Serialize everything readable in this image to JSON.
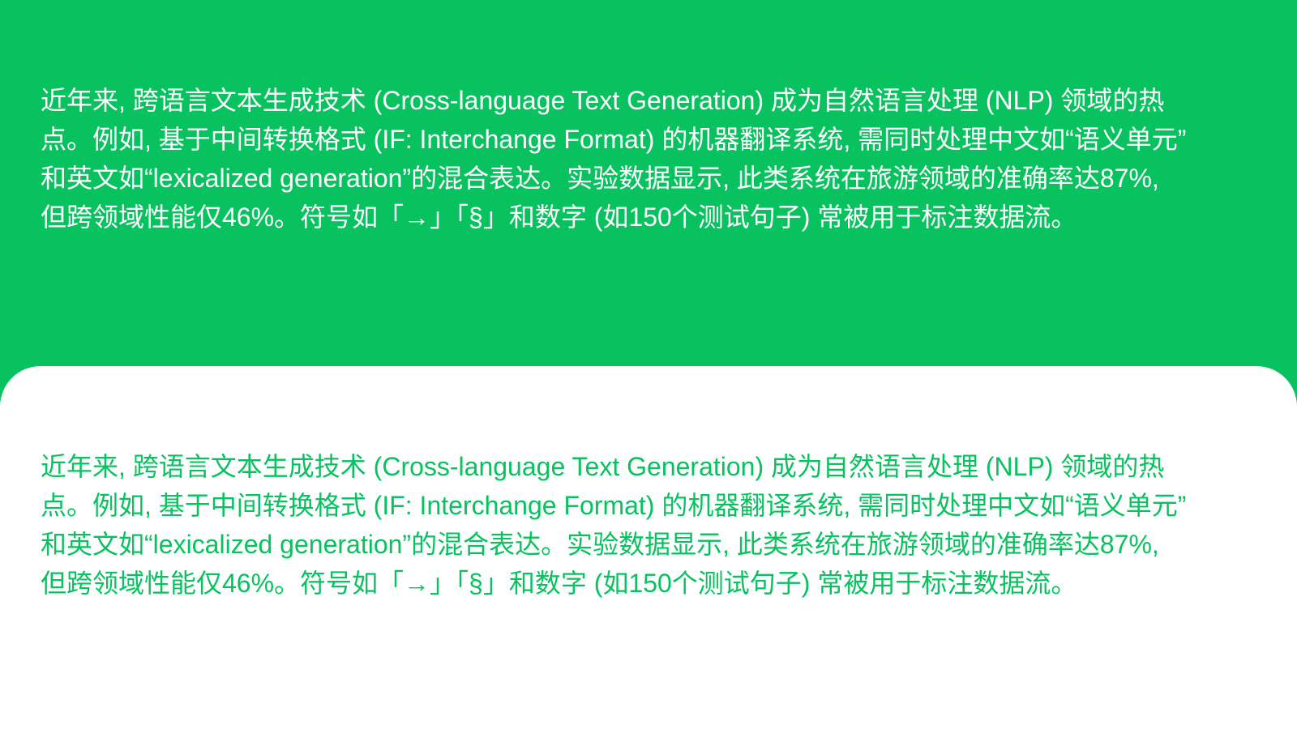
{
  "colors": {
    "accent_green": "#08c25f",
    "background_white": "#ffffff"
  },
  "paragraph": {
    "lines": [
      "近年来, 跨语言文本生成技术 (Cross-language Text Generation) 成为自然语言处理 (NLP) 领域的热",
      "点。例如, 基于中间转换格式 (IF: Interchange Format) 的机器翻译系统, 需同时处理中文如“语义单元”",
      "和英文如“lexicalized generation”的混合表达。实验数据显示, 此类系统在旅游领域的准确率达87%,",
      "但跨领域性能仅46%。符号如「→」「§」和数字 (如150个测试句子) 常被用于标注数据流。"
    ]
  }
}
